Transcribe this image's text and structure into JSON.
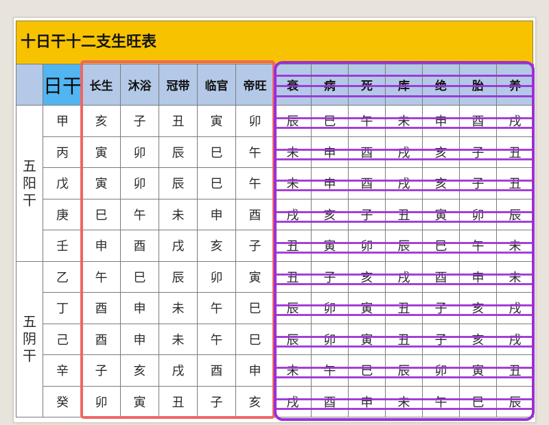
{
  "title": "十日干十二支生旺表",
  "header": {
    "stem_label": "日干",
    "stages": [
      "长生",
      "沐浴",
      "冠带",
      "临官",
      "帝旺",
      "衰",
      "病",
      "死",
      "库",
      "绝",
      "胎",
      "养"
    ]
  },
  "groups": [
    {
      "label": "五阳干",
      "rows": [
        {
          "stem": "甲",
          "branches": [
            "亥",
            "子",
            "丑",
            "寅",
            "卯",
            "辰",
            "巳",
            "午",
            "未",
            "申",
            "酉",
            "戌"
          ]
        },
        {
          "stem": "丙",
          "branches": [
            "寅",
            "卯",
            "辰",
            "巳",
            "午",
            "未",
            "申",
            "酉",
            "戌",
            "亥",
            "子",
            "丑"
          ]
        },
        {
          "stem": "戊",
          "branches": [
            "寅",
            "卯",
            "辰",
            "巳",
            "午",
            "未",
            "申",
            "酉",
            "戌",
            "亥",
            "子",
            "丑"
          ]
        },
        {
          "stem": "庚",
          "branches": [
            "巳",
            "午",
            "未",
            "申",
            "酉",
            "戌",
            "亥",
            "子",
            "丑",
            "寅",
            "卯",
            "辰"
          ]
        },
        {
          "stem": "壬",
          "branches": [
            "申",
            "酉",
            "戌",
            "亥",
            "子",
            "丑",
            "寅",
            "卯",
            "辰",
            "巳",
            "午",
            "未"
          ]
        }
      ]
    },
    {
      "label": "五阴干",
      "rows": [
        {
          "stem": "乙",
          "branches": [
            "午",
            "巳",
            "辰",
            "卯",
            "寅",
            "丑",
            "子",
            "亥",
            "戌",
            "酉",
            "申",
            "未"
          ]
        },
        {
          "stem": "丁",
          "branches": [
            "酉",
            "申",
            "未",
            "午",
            "巳",
            "辰",
            "卯",
            "寅",
            "丑",
            "子",
            "亥",
            "戌"
          ]
        },
        {
          "stem": "己",
          "branches": [
            "酉",
            "申",
            "未",
            "午",
            "巳",
            "辰",
            "卯",
            "寅",
            "丑",
            "子",
            "亥",
            "戌"
          ]
        },
        {
          "stem": "辛",
          "branches": [
            "子",
            "亥",
            "戌",
            "酉",
            "申",
            "未",
            "午",
            "巳",
            "辰",
            "卯",
            "寅",
            "丑"
          ]
        },
        {
          "stem": "癸",
          "branches": [
            "卯",
            "寅",
            "丑",
            "子",
            "亥",
            "戌",
            "酉",
            "申",
            "未",
            "午",
            "巳",
            "辰"
          ]
        }
      ]
    }
  ],
  "colors": {
    "frame": "#e8e4db",
    "panel": "#ffffff",
    "title_bar": "#f7c300",
    "header_cell": "#b3c9e7",
    "stem_header_cell": "#52b5f1",
    "grid_line": "#7a7a7a",
    "red_box": "#f06565",
    "purple_marks": "#9b2fd6",
    "text": "#2a2a2a"
  }
}
